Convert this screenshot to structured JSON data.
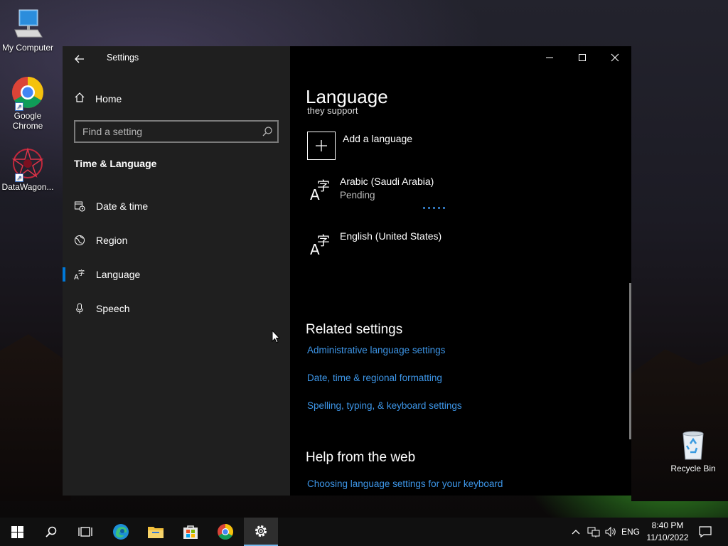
{
  "desktop": {
    "icons": [
      {
        "label": "My Computer"
      },
      {
        "label": "Google Chrome"
      },
      {
        "label": "DataWagon..."
      },
      {
        "label": "Recycle Bin"
      }
    ]
  },
  "window": {
    "app_title": "Settings",
    "home_label": "Home",
    "search_placeholder": "Find a setting",
    "section_heading": "Time & Language",
    "nav": [
      {
        "label": "Date & time",
        "icon": "calendar-clock-icon"
      },
      {
        "label": "Region",
        "icon": "globe-icon"
      },
      {
        "label": "Language",
        "icon": "language-icon",
        "active": true
      },
      {
        "label": "Speech",
        "icon": "microphone-icon"
      }
    ],
    "content": {
      "page_title": "Language",
      "clipped_text": "they support",
      "add_language_label": "Add a language",
      "languages": [
        {
          "name": "Arabic (Saudi Arabia)",
          "status": "Pending"
        },
        {
          "name": "English (United States)",
          "status": ""
        }
      ],
      "related_heading": "Related settings",
      "related_links": [
        "Administrative language settings",
        "Date, time & regional formatting",
        "Spelling, typing, & keyboard settings"
      ],
      "help_heading": "Help from the web",
      "help_links": [
        "Choosing language settings for your keyboard"
      ]
    }
  },
  "taskbar": {
    "language_indicator": "ENG",
    "time": "8:40 PM",
    "date": "11/10/2022"
  },
  "colors": {
    "accent": "#0078d7",
    "link": "#3d96e8",
    "sidebar_bg": "#1f1f1f",
    "content_bg": "#000000"
  }
}
